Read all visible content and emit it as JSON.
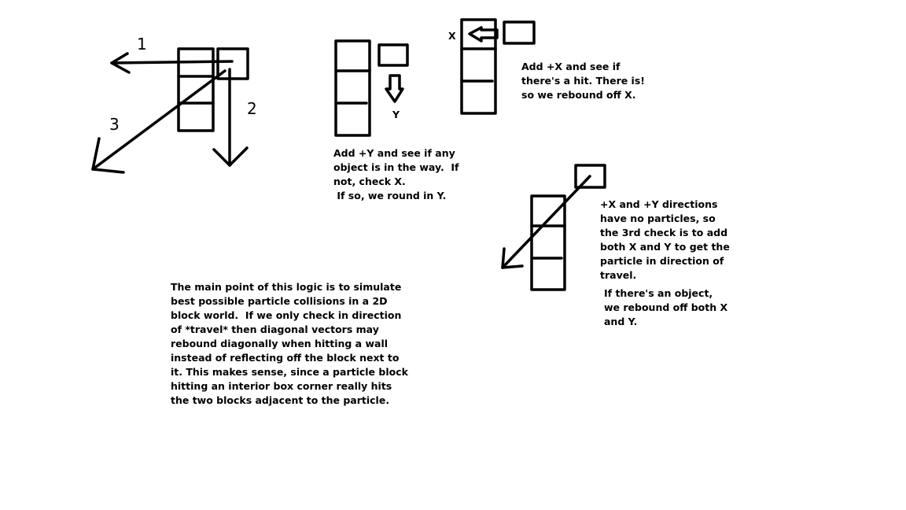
{
  "diagram": {
    "stroke_color": "#000000",
    "background": "#ffffff",
    "hand_labels": [
      "1",
      "2",
      "3"
    ],
    "axis_labels": {
      "y": "Y",
      "x": "X"
    },
    "notes": {
      "y_check": "Add +Y and see if any\nobject is in the way.  If\nnot, check X.\n If so, we round in Y.",
      "x_check": "Add +X and see if\nthere's a hit. There is!\nso we rebound off X.",
      "both_check": "+X and +Y directions\nhave no particles, so\nthe 3rd check is to add\nboth X and Y to get the\nparticle in direction of\ntravel.",
      "both_result": "If there's an object,\nwe rebound off both X\nand Y.",
      "main_point": "The main point of this logic is to simulate\nbest possible particle collisions in a 2D\nblock world.  If we only check in direction\nof *travel* then diagonal vectors may\nrebound diagonally when hitting a wall\ninstead of reflecting off the block next to\nit. This makes sense, since a particle block\nhitting an interior box corner really hits\nthe two blocks adjacent to the particle."
    }
  }
}
